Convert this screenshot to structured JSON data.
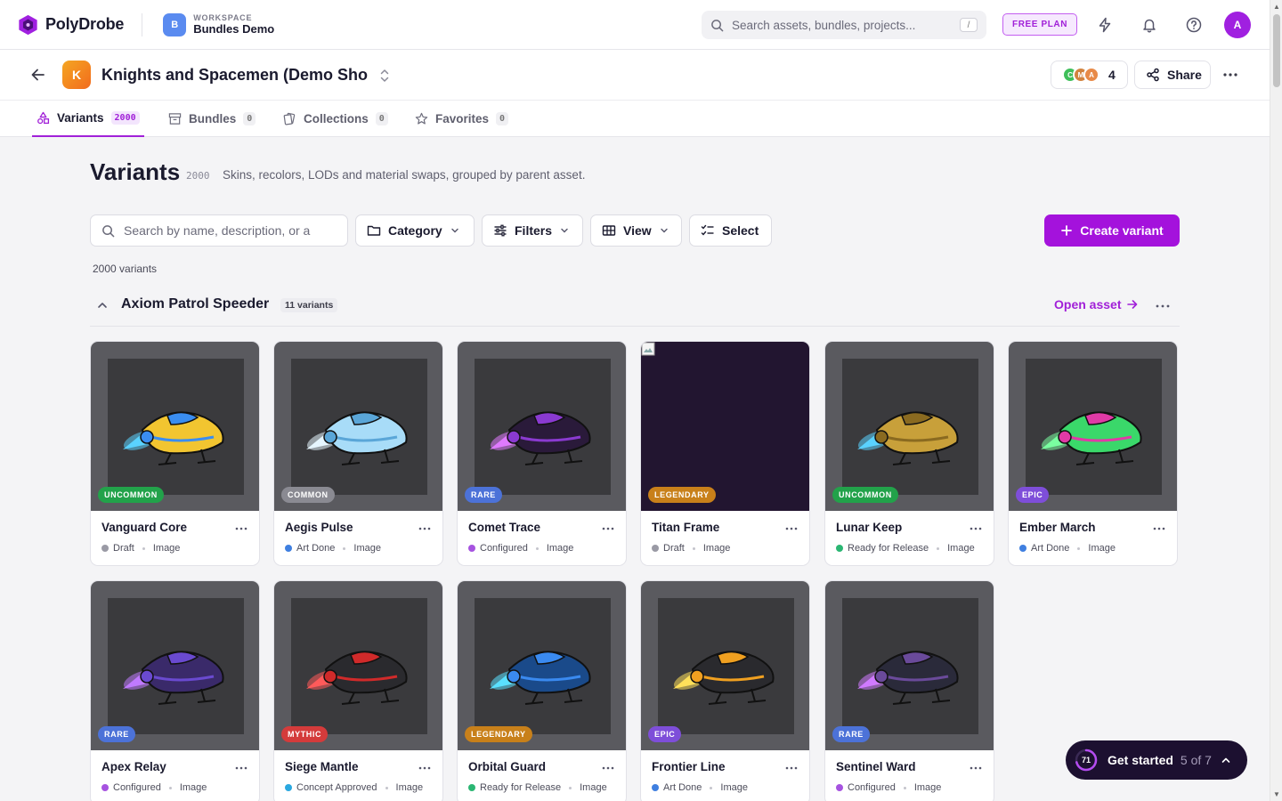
{
  "app": {
    "brand": "PolyDrobe",
    "workspace_label": "WORKSPACE",
    "workspace_initial": "B",
    "workspace_name": "Bundles Demo",
    "search_placeholder": "Search assets, bundles, projects...",
    "search_shortcut": "/",
    "plan_badge": "FREE PLAN",
    "user_initial": "A"
  },
  "project": {
    "initial": "K",
    "title": "Knights and Spacemen (Demo Sho...",
    "collaborators": [
      {
        "initial": "C",
        "color": "#3fbf5a"
      },
      {
        "initial": "M",
        "color": "#d2833f"
      },
      {
        "initial": "A",
        "color": "#e88a48"
      }
    ],
    "collaborator_count": "4",
    "share_label": "Share"
  },
  "tabs": [
    {
      "label": "Variants",
      "count": "2000",
      "icon": "variants-icon",
      "active": true
    },
    {
      "label": "Bundles",
      "count": "0",
      "icon": "bundle-box-icon",
      "active": false
    },
    {
      "label": "Collections",
      "count": "0",
      "icon": "collections-icon",
      "active": false
    },
    {
      "label": "Favorites",
      "count": "0",
      "icon": "star-icon",
      "active": false
    }
  ],
  "page": {
    "title": "Variants",
    "count": "2000",
    "description": "Skins, recolors, LODs and material swaps, grouped by parent asset.",
    "search_placeholder": "Search by name, description, or a",
    "category_label": "Category",
    "filters_label": "Filters",
    "view_label": "View",
    "select_label": "Select",
    "create_label": "Create variant",
    "total_label": "2000 variants"
  },
  "group": {
    "name": "Axiom Patrol Speeder",
    "count_label": "11 variants",
    "open_label": "Open asset"
  },
  "rarity_colors": {
    "UNCOMMON": "#22a24a",
    "COMMON": "#8a8a92",
    "RARE": "#4c72d8",
    "LEGENDARY": "#c8801a",
    "EPIC": "#7e4ed9",
    "MYTHIC": "#d43b3b"
  },
  "status_colors": {
    "Draft": "#9a9aa5",
    "Art Done": "#3f7fe0",
    "Configured": "#a653e0",
    "Ready for Release": "#2bb673",
    "Concept Approved": "#2aa8e0"
  },
  "variants": [
    {
      "name": "Vanguard Core",
      "rarity": "UNCOMMON",
      "status": "Draft",
      "type": "Image",
      "palette": [
        "#f2c530",
        "#3a8df0",
        "#5ad2ff"
      ]
    },
    {
      "name": "Aegis Pulse",
      "rarity": "COMMON",
      "status": "Art Done",
      "type": "Image",
      "palette": [
        "#a8dcf8",
        "#5aa6d8",
        "#e6f6ff"
      ]
    },
    {
      "name": "Comet Trace",
      "rarity": "RARE",
      "status": "Configured",
      "type": "Image",
      "palette": [
        "#2a1a3a",
        "#8a3ad0",
        "#e07aff"
      ]
    },
    {
      "name": "Titan Frame",
      "rarity": "LEGENDARY",
      "status": "Draft",
      "type": "Image",
      "palette": []
    },
    {
      "name": "Lunar Keep",
      "rarity": "UNCOMMON",
      "status": "Ready for Release",
      "type": "Image",
      "palette": [
        "#c8a03a",
        "#8a6a20",
        "#5ad2ff"
      ]
    },
    {
      "name": "Ember March",
      "rarity": "EPIC",
      "status": "Art Done",
      "type": "Image",
      "palette": [
        "#3ad86a",
        "#e03aa6",
        "#7affa0"
      ]
    },
    {
      "name": "Apex Relay",
      "rarity": "RARE",
      "status": "Configured",
      "type": "Image",
      "palette": [
        "#3a2a6a",
        "#6a4ad0",
        "#c07aff"
      ]
    },
    {
      "name": "Siege Mantle",
      "rarity": "MYTHIC",
      "status": "Concept Approved",
      "type": "Image",
      "palette": [
        "#2a2a2e",
        "#d02a2a",
        "#ff5a5a"
      ]
    },
    {
      "name": "Orbital Guard",
      "rarity": "LEGENDARY",
      "status": "Ready for Release",
      "type": "Image",
      "palette": [
        "#1a4a8a",
        "#3a8af0",
        "#5ae0ff"
      ]
    },
    {
      "name": "Frontier Line",
      "rarity": "EPIC",
      "status": "Art Done",
      "type": "Image",
      "palette": [
        "#2a2a2e",
        "#f0a020",
        "#ffe05a"
      ]
    },
    {
      "name": "Sentinel Ward",
      "rarity": "RARE",
      "status": "Configured",
      "type": "Image",
      "palette": [
        "#2a2a3a",
        "#6a4a9a",
        "#d07aff"
      ]
    }
  ],
  "get_started": {
    "score": "71",
    "label": "Get started",
    "progress": "5 of 7"
  }
}
